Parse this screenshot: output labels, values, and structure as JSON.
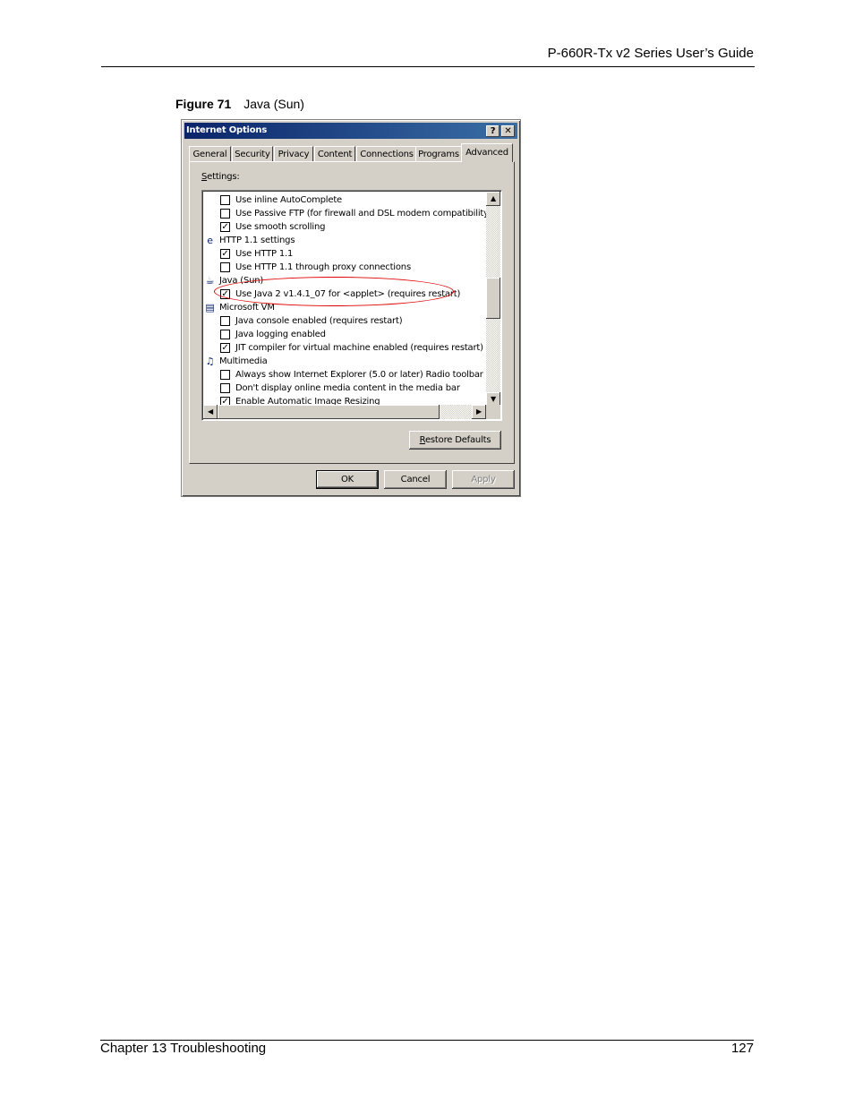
{
  "header": {
    "title": "P-660R-Tx v2 Series User’s Guide"
  },
  "figure": {
    "label": "Figure 71",
    "caption": "Java (Sun)"
  },
  "dialog": {
    "title": "Internet Options",
    "help_btn": "?",
    "close_btn": "✕",
    "tabs": [
      "General",
      "Security",
      "Privacy",
      "Content",
      "Connections",
      "Programs",
      "Advanced"
    ],
    "active_tab": "Advanced",
    "settings_label": "Settings:",
    "items": [
      {
        "kind": "check",
        "checked": false,
        "label": "Use inline AutoComplete"
      },
      {
        "kind": "check",
        "checked": false,
        "label": "Use Passive FTP (for firewall and DSL modem compatibility)"
      },
      {
        "kind": "check",
        "checked": true,
        "label": "Use smooth scrolling"
      },
      {
        "kind": "group",
        "icon": "ie-icon",
        "label": "HTTP 1.1 settings"
      },
      {
        "kind": "check",
        "checked": true,
        "label": "Use HTTP 1.1"
      },
      {
        "kind": "check",
        "checked": false,
        "label": "Use HTTP 1.1 through proxy connections"
      },
      {
        "kind": "group",
        "icon": "java-icon",
        "label": "Java (Sun)"
      },
      {
        "kind": "check",
        "checked": true,
        "label": "Use Java 2 v1.4.1_07 for <applet> (requires restart)"
      },
      {
        "kind": "group",
        "icon": "document-icon",
        "label": "Microsoft VM"
      },
      {
        "kind": "check",
        "checked": false,
        "label": "Java console enabled (requires restart)"
      },
      {
        "kind": "check",
        "checked": false,
        "label": "Java logging enabled"
      },
      {
        "kind": "check",
        "checked": true,
        "label": "JIT compiler for virtual machine enabled (requires restart)"
      },
      {
        "kind": "group",
        "icon": "multimedia-icon",
        "label": "Multimedia"
      },
      {
        "kind": "check",
        "checked": false,
        "label": "Always show Internet Explorer (5.0 or later) Radio toolbar"
      },
      {
        "kind": "check",
        "checked": false,
        "label": "Don't display online media content in the media bar"
      },
      {
        "kind": "check",
        "checked": true,
        "label": "Enable Automatic Image Resizing"
      }
    ],
    "restore_defaults": {
      "accel": "R",
      "rest": "estore Defaults"
    },
    "ok": "OK",
    "cancel": "Cancel",
    "apply": "Apply"
  },
  "footer": {
    "chapter": "Chapter 13 Troubleshooting",
    "page": "127"
  },
  "colors": {
    "titlebar": "#0a246a",
    "face": "#d4d0c8",
    "highlight_ring": "#e00000"
  }
}
